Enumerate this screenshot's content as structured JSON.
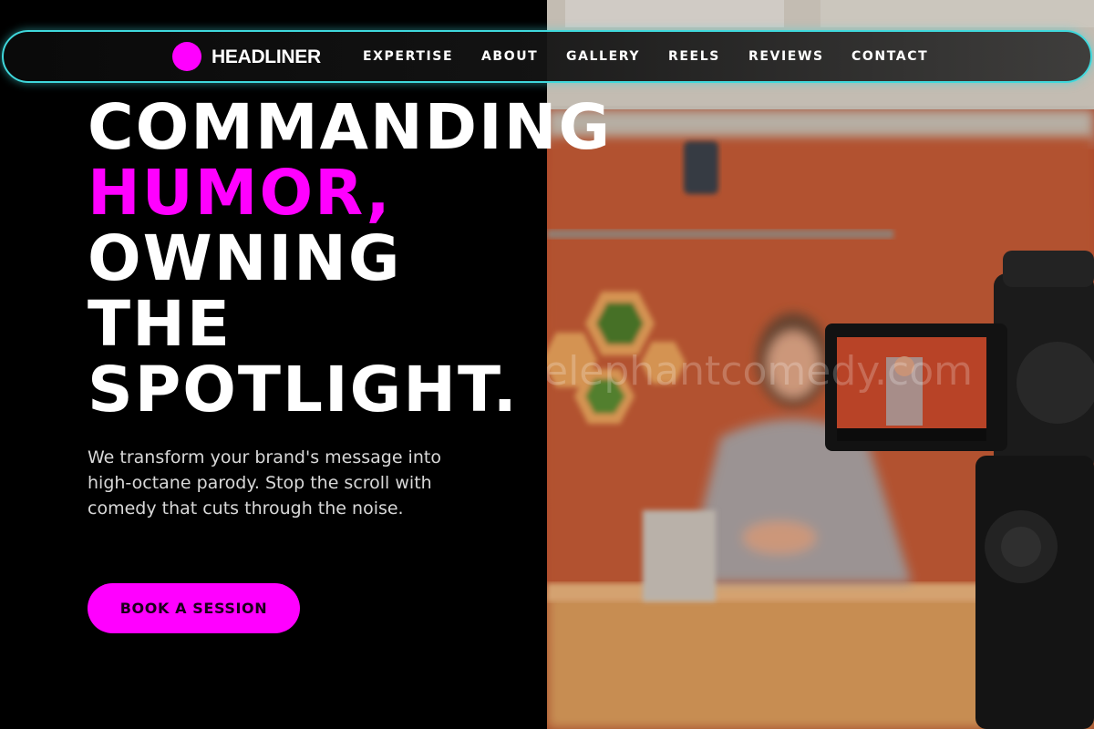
{
  "nav": {
    "brand": "HEADLINER",
    "links": [
      "EXPERTISE",
      "ABOUT",
      "GALLERY",
      "REELS",
      "REVIEWS",
      "CONTACT"
    ]
  },
  "hero": {
    "headline": {
      "line1": "COMMANDING",
      "line2": "HUMOR,",
      "line3": "OWNING",
      "line4": "THE",
      "line5": "SPOTLIGHT."
    },
    "subtext": "We transform your brand's message into high-octane parody. Stop the scroll with comedy that cuts through the noise.",
    "cta_label": "BOOK A SESSION"
  },
  "photo": {
    "watermark": "elephantcomedy.com"
  },
  "colors": {
    "accent": "#ff00ff",
    "nav_border": "#3fd8dc",
    "background": "#000000",
    "text": "#ffffff"
  }
}
